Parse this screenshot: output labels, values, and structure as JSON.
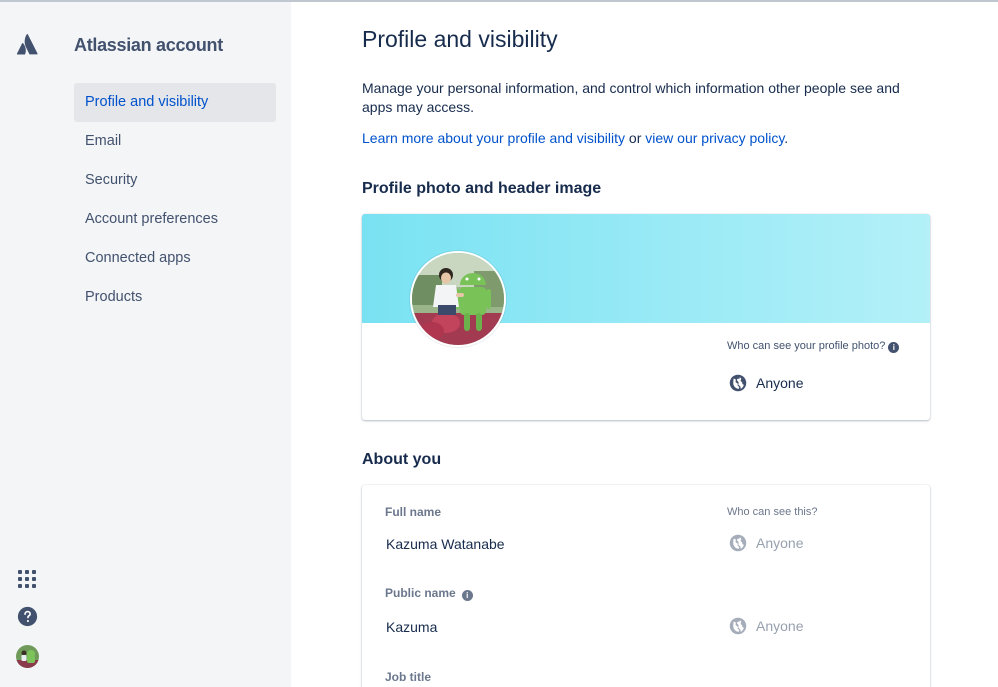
{
  "app": {
    "title": "Atlassian account"
  },
  "sidebar": {
    "items": [
      {
        "label": "Profile and visibility",
        "active": true
      },
      {
        "label": "Email",
        "active": false
      },
      {
        "label": "Security",
        "active": false
      },
      {
        "label": "Account preferences",
        "active": false
      },
      {
        "label": "Connected apps",
        "active": false
      },
      {
        "label": "Products",
        "active": false
      }
    ],
    "bottom_icons": [
      "apps-icon",
      "help-icon",
      "user-avatar"
    ]
  },
  "main": {
    "title": "Profile and visibility",
    "intro": "Manage your personal information, and control which information other people see and apps may access.",
    "links": {
      "learn_more": "Learn more about your profile and visibility",
      "or": " or ",
      "privacy": "view our privacy policy",
      "period": "."
    },
    "photo_section": {
      "heading": "Profile photo and header image",
      "who_can_see": "Who can see your profile photo?",
      "visibility": "Anyone"
    },
    "about_section": {
      "heading": "About you",
      "who_can_see": "Who can see this?",
      "fields": [
        {
          "label": "Full name",
          "value": "Kazuma Watanabe",
          "visibility": "Anyone",
          "has_info": false
        },
        {
          "label": "Public name",
          "value": "Kazuma",
          "visibility": "Anyone",
          "has_info": true
        },
        {
          "label": "Job title",
          "value": "",
          "visibility": "",
          "has_info": false
        }
      ]
    }
  },
  "colors": {
    "accent": "#0052cc",
    "text": "#172b4d",
    "sidebar_bg": "#f4f5f7",
    "header_image": "#79e2f2"
  }
}
